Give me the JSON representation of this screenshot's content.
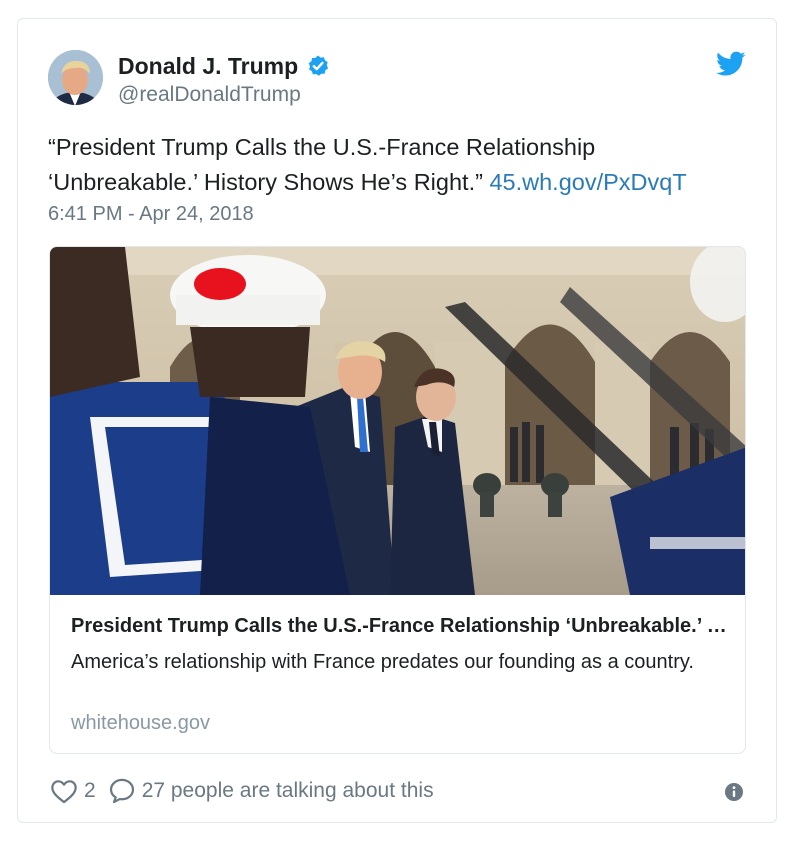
{
  "author": {
    "display_name": "Donald J. Trump",
    "handle": "@realDonaldTrump",
    "verified": true,
    "avatar_icon": "profile-photo"
  },
  "tweet": {
    "text": "“President Trump Calls the U.S.-France Relationship ‘Unbreakable.’ History Shows He’s Right.”",
    "link_text": "45.wh.gov/PxDvqT",
    "timestamp": "6:41 PM - Apr 24, 2018"
  },
  "card": {
    "title": "President Trump Calls the U.S.-France Relationship ‘Unbreakable.’ History Shows He’s Right.",
    "description": "America’s relationship with France predates our founding as a country.",
    "domain": "whitehouse.gov"
  },
  "actions": {
    "like_count": "2",
    "reply_text": "27 people are talking about this"
  },
  "colors": {
    "link": "#2b7bb9",
    "verified": "#1da1f2",
    "twitter_brand": "#1da1f2",
    "secondary_text": "#697882"
  },
  "icons": {
    "brand": "twitter-bird-icon",
    "verified": "verified-badge-icon",
    "like": "heart-icon",
    "reply": "reply-bubble-icon",
    "info": "info-icon"
  }
}
